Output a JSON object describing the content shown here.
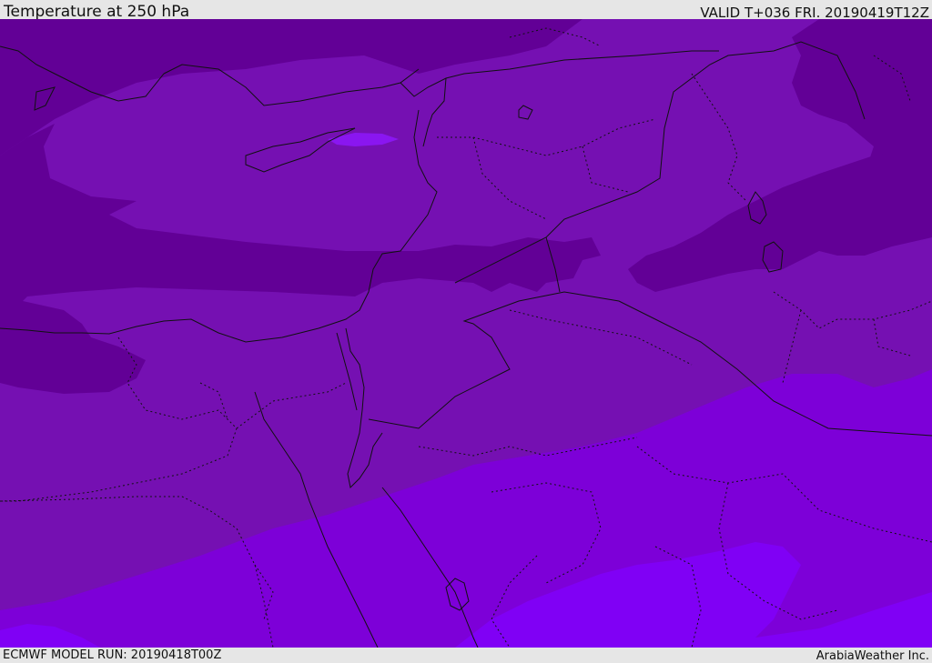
{
  "header": {
    "title": "Temperature at 250 hPa",
    "valid": "VALID T+036 FRI. 20190419T12Z"
  },
  "footer": {
    "model_run": "ECMWF MODEL RUN: 20190418T00Z",
    "credit": "ArabiaWeather Inc."
  },
  "map": {
    "field": "temperature-250hPa",
    "colors": {
      "cold_dark": "#620096",
      "mid": "#7510b2",
      "warm": "#7d00d8",
      "warmest": "#8000f5",
      "highlight": "#8a16f0",
      "borders": "#111111"
    }
  }
}
